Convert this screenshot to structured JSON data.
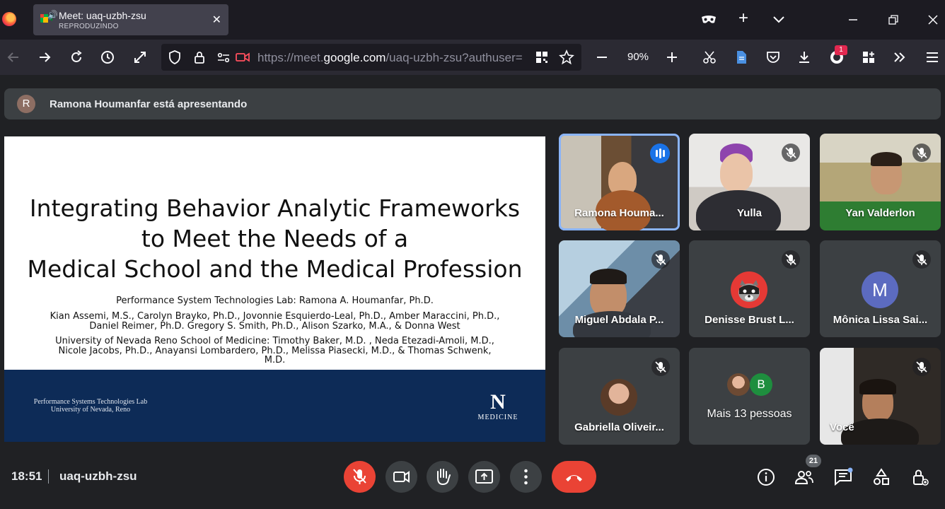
{
  "browser": {
    "tab": {
      "title": "Meet: uaq-uzbh-zsu",
      "subtitle": "REPRODUZINDO"
    },
    "url": {
      "host_prefix": "https://meet.",
      "host": "google.com",
      "path": "/uaq-uzbh-zsu?authuser="
    },
    "zoom": "90%",
    "notification_count": "1"
  },
  "presenting": {
    "avatar_letter": "R",
    "text": "Ramona Houmanfar está apresentando"
  },
  "slide": {
    "title_lines": [
      "Integrating Behavior Analytic Frameworks",
      "to Meet the Needs of a",
      "Medical School and the Medical Profession"
    ],
    "lab_line": "Performance System Technologies Lab: Ramona A. Houmanfar, Ph.D.",
    "authors_1": "Kian Assemi, M.S., Carolyn Brayko, Ph.D., Jovonnie Esquierdo-Leal, Ph.D.,  Amber Maraccini, Ph.D.,",
    "authors_2": "Daniel Reimer, Ph.D. Gregory S. Smith, Ph.D.,   Alison Szarko, M.A., & Donna West",
    "school_1": "University of Nevada Reno School of Medicine: Timothy Baker, M.D. , Neda Etezadi-Amoli, M.D.,",
    "school_2": "Nicole Jacobs, Ph.D., Anayansi Lombardero, Ph.D., Melissa Piasecki, M.D., & Thomas Schwenk,",
    "school_3": "M.D.",
    "footer_lab_1": "Performance Systems Technologies Lab",
    "footer_lab_2": "University of Nevada, Reno",
    "footer_logo_letter": "N",
    "footer_logo_text": "MEDICINE"
  },
  "participants": [
    {
      "name": "Ramona Houma...",
      "state": "speaking"
    },
    {
      "name": "Yulla",
      "state": "muted"
    },
    {
      "name": "Yan Valderlon",
      "state": "muted"
    },
    {
      "name": "Miguel Abdala P...",
      "state": "muted"
    },
    {
      "name": "Denisse Brust L...",
      "state": "muted"
    },
    {
      "name": "Mônica Lissa Sai...",
      "state": "muted",
      "avatar_letter": "M"
    },
    {
      "name": "Gabriella Oliveir...",
      "state": "muted"
    },
    {
      "name": "Mais 13 pessoas",
      "avatar_letter": "B"
    },
    {
      "name": "Você",
      "state": "muted"
    }
  ],
  "bottom": {
    "time": "18:51",
    "meeting_code": "uaq-uzbh-zsu",
    "people_count": "21"
  },
  "colors": {
    "accent": "#8ab4f8",
    "danger": "#ea4335",
    "surface": "#3c4043",
    "background": "#202124",
    "slide_footer": "#0d2b57",
    "monica_avatar": "#5c6bc0",
    "b_avatar": "#1e8e3e"
  }
}
